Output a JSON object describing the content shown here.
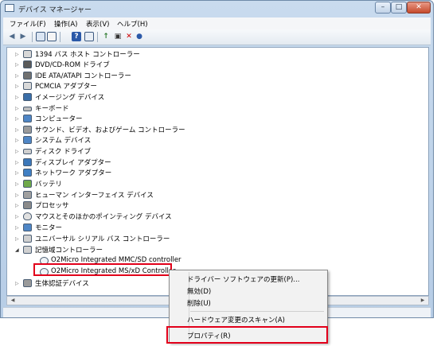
{
  "window": {
    "title": "デバイス マネージャー",
    "buttons": {
      "minimize": "–",
      "maximize": "□",
      "close": "✕"
    }
  },
  "menubar": {
    "items": [
      "ファイル(F)",
      "操作(A)",
      "表示(V)",
      "ヘルプ(H)"
    ]
  },
  "toolbar": {
    "buttons": [
      "back-icon",
      "forward-icon",
      "show-hide-tree-icon",
      "properties-icon",
      "help-icon",
      "scan-hardware-icon",
      "update-driver-icon",
      "disable-device-icon",
      "uninstall-device-icon"
    ]
  },
  "tree": {
    "nodes": [
      {
        "label": "1394 バス ホスト コントローラー",
        "icon": "1394-bus-icon"
      },
      {
        "label": "DVD/CD-ROM ドライブ",
        "icon": "dvd-drive-icon"
      },
      {
        "label": "IDE ATA/ATAPI コントローラー",
        "icon": "ide-controller-icon"
      },
      {
        "label": "PCMCIA アダプター",
        "icon": "pcmcia-icon"
      },
      {
        "label": "イメージング デバイス",
        "icon": "camera-icon"
      },
      {
        "label": "キーボード",
        "icon": "keyboard-icon"
      },
      {
        "label": "コンピューター",
        "icon": "computer-icon"
      },
      {
        "label": "サウンド、ビデオ、およびゲーム コントローラー",
        "icon": "speaker-icon"
      },
      {
        "label": "システム デバイス",
        "icon": "system-device-icon"
      },
      {
        "label": "ディスク ドライブ",
        "icon": "disk-drive-icon"
      },
      {
        "label": "ディスプレイ アダプター",
        "icon": "display-adapter-icon"
      },
      {
        "label": "ネットワーク アダプター",
        "icon": "network-adapter-icon"
      },
      {
        "label": "バッテリ",
        "icon": "battery-icon"
      },
      {
        "label": "ヒューマン インターフェイス デバイス",
        "icon": "hid-icon"
      },
      {
        "label": "プロセッサ",
        "icon": "processor-icon"
      },
      {
        "label": "マウスとそのほかのポインティング デバイス",
        "icon": "mouse-icon"
      },
      {
        "label": "モニター",
        "icon": "monitor-icon"
      },
      {
        "label": "ユニバーサル シリアル バス コントローラー",
        "icon": "usb-icon"
      },
      {
        "label": "記憶域コントローラー",
        "icon": "storage-controller-icon",
        "expanded": true
      }
    ],
    "children": [
      {
        "label": "O2Micro Integrated MMC/SD controller",
        "icon": "controller-device-icon"
      },
      {
        "label": "O2Micro Integrated MS/xD Controller",
        "icon": "controller-device-icon",
        "selected": true
      }
    ],
    "after": [
      {
        "label": "生体認証デバイス",
        "icon": "biometric-icon"
      }
    ]
  },
  "context_menu": {
    "items": [
      "ドライバー ソフトウェアの更新(P)...",
      "無効(D)",
      "削除(U)",
      "ハードウェア変更のスキャン(A)",
      "プロパティ(R)"
    ]
  },
  "colors": {
    "highlight": "#e2001a",
    "title_bar": "#c9dbee",
    "menu_bg": "#f2f2f2"
  }
}
